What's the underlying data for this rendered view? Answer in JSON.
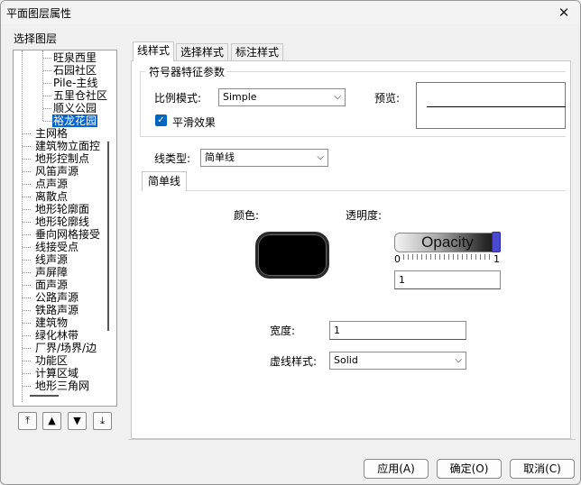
{
  "window": {
    "title": "平面图层属性",
    "close": "✕"
  },
  "layer_group": {
    "label": "选择图层",
    "children": [
      "旺泉西里",
      "石园社区",
      "Pile-主线",
      "五里仓社区",
      "顺义公园"
    ],
    "selected": "裕龙花园",
    "items": [
      "主网格",
      "建筑物立面控",
      "地形控制点",
      "风笛声源",
      "点声源",
      "离散点",
      "地形轮廓面",
      "地形轮廓线",
      "垂向网格接受",
      "线接受点",
      "线声源",
      "声屏障",
      "面声源",
      "公路声源",
      "铁路声源",
      "建筑物",
      "绿化林带",
      "厂界/场界/边",
      "功能区",
      "计算区域",
      "地形三角网"
    ]
  },
  "move_buttons": [
    "⤒",
    "▲",
    "▼",
    "⤓"
  ],
  "tabs": [
    "线样式",
    "选择样式",
    "标注样式"
  ],
  "symbolizer": {
    "legend": "符号器特征参数",
    "scale_mode_label": "比例模式:",
    "scale_mode_value": "Simple",
    "preview_label": "预览:",
    "smooth_label": "平滑效果",
    "smooth_checked": true
  },
  "line_type": {
    "label": "线类型:",
    "value": "简单线"
  },
  "simple_line": {
    "tab": "简单线",
    "color_label": "颜色:",
    "color": "#000000",
    "opacity_label": "透明度:",
    "opacity_text": "Opacity",
    "opacity_min": "0",
    "opacity_max": "1",
    "opacity_value": "1",
    "width_label": "宽度:",
    "width_value": "1",
    "dash_label": "虚线样式:",
    "dash_value": "Solid"
  },
  "buttons": {
    "apply": "应用(A)",
    "ok": "确定(O)",
    "cancel": "取消(C)"
  }
}
